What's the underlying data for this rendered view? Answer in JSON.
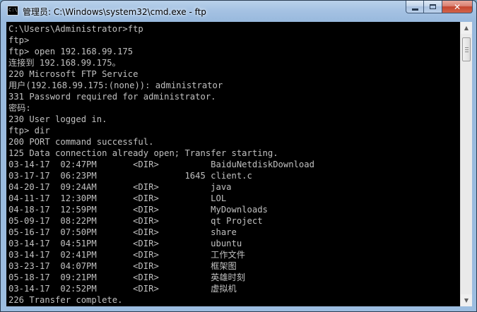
{
  "window": {
    "title": "管理员: C:\\Windows\\system32\\cmd.exe - ftp",
    "app_icon_text": "C:\\"
  },
  "console": {
    "lines": [
      "C:\\Users\\Administrator>ftp",
      "ftp>",
      "ftp> open 192.168.99.175",
      "连接到 192.168.99.175。",
      "220 Microsoft FTP Service",
      "用户(192.168.99.175:(none)): administrator",
      "331 Password required for administrator.",
      "密码:",
      "230 User logged in.",
      "ftp> dir",
      "200 PORT command successful.",
      "125 Data connection already open; Transfer starting.",
      "03-14-17  02:47PM       <DIR>          BaiduNetdiskDownload",
      "03-17-17  06:23PM                 1645 client.c",
      "04-20-17  09:24AM       <DIR>          java",
      "04-11-17  12:30PM       <DIR>          LOL",
      "04-18-17  12:59PM       <DIR>          MyDownloads",
      "05-09-17  08:22PM       <DIR>          qt Project",
      "05-16-17  07:50PM       <DIR>          share",
      "03-14-17  04:51PM       <DIR>          ubuntu",
      "03-14-17  02:41PM       <DIR>          工作文件",
      "03-23-17  04:07PM       <DIR>          框架图",
      "05-18-17  09:21PM       <DIR>          英雄时刻",
      "03-14-17  02:52PM       <DIR>          虚拟机",
      "226 Transfer complete."
    ]
  },
  "scrollbar": {
    "position": 0.03
  },
  "colors": {
    "console_bg": "#000000",
    "console_text": "#c0c0c0",
    "close_button": "#c4452f"
  }
}
